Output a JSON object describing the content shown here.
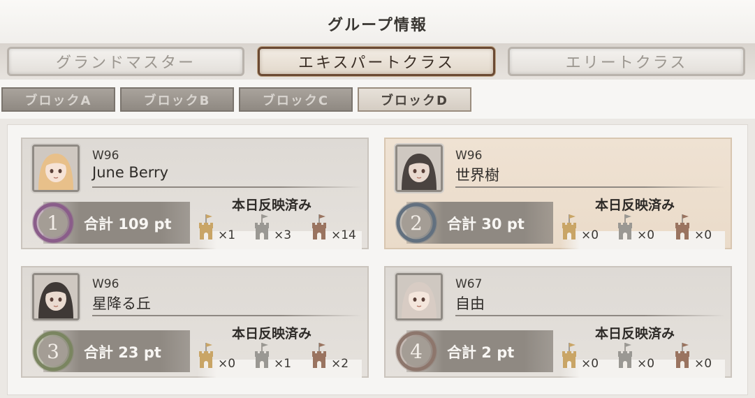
{
  "header": {
    "title": "グループ情報"
  },
  "tabs": [
    {
      "label": "グランドマスター",
      "active": false
    },
    {
      "label": "エキスパートクラス",
      "active": true
    },
    {
      "label": "エリートクラス",
      "active": false
    }
  ],
  "blocks": [
    {
      "label": "ブロックA",
      "active": false
    },
    {
      "label": "ブロックB",
      "active": false
    },
    {
      "label": "ブロックC",
      "active": false
    },
    {
      "label": "ブロックD",
      "active": true
    }
  ],
  "colors": {
    "gold_tower": "#c9a566",
    "silver_tower": "#9a9893",
    "bronze_tower": "#9a7460",
    "rank1": "#8a5d8a",
    "rank2": "#62707f",
    "rank3": "#7a8560",
    "rank4": "#8d766c"
  },
  "cards": [
    {
      "rank": "1",
      "server": "W96",
      "name": "June Berry",
      "score": "合計 109 pt",
      "status": "本日反映済み",
      "towers": [
        {
          "icon": "gold-tower-icon",
          "count": "×1"
        },
        {
          "icon": "silver-tower-icon",
          "count": "×3"
        },
        {
          "icon": "bronze-tower-icon",
          "count": "×14"
        }
      ]
    },
    {
      "rank": "2",
      "server": "W96",
      "name": "世界樹",
      "score": "合計 30 pt",
      "status": "本日反映済み",
      "towers": [
        {
          "icon": "gold-tower-icon",
          "count": "×0"
        },
        {
          "icon": "silver-tower-icon",
          "count": "×0"
        },
        {
          "icon": "bronze-tower-icon",
          "count": "×0"
        }
      ]
    },
    {
      "rank": "3",
      "server": "W96",
      "name": "星降る丘",
      "score": "合計 23 pt",
      "status": "本日反映済み",
      "towers": [
        {
          "icon": "gold-tower-icon",
          "count": "×0"
        },
        {
          "icon": "silver-tower-icon",
          "count": "×1"
        },
        {
          "icon": "bronze-tower-icon",
          "count": "×2"
        }
      ]
    },
    {
      "rank": "4",
      "server": "W67",
      "name": "自由",
      "score": "合計 2 pt",
      "status": "本日反映済み",
      "towers": [
        {
          "icon": "gold-tower-icon",
          "count": "×0"
        },
        {
          "icon": "silver-tower-icon",
          "count": "×0"
        },
        {
          "icon": "bronze-tower-icon",
          "count": "×0"
        }
      ]
    }
  ]
}
